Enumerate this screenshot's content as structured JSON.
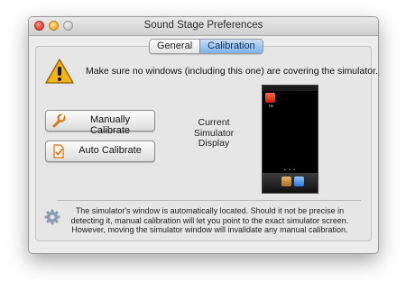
{
  "window": {
    "title": "Sound Stage Preferences",
    "controls": [
      "close-icon",
      "minimize-icon",
      "zoom-icon"
    ]
  },
  "tabs": [
    {
      "label": "General",
      "selected": false
    },
    {
      "label": "Calibration",
      "selected": true
    }
  ],
  "warning": {
    "icon": "warning-icon",
    "text": "Make sure no windows (including this one) are covering the simulator."
  },
  "buttons": {
    "manual": {
      "label": "Manually Calibrate",
      "icon": "wrench-icon"
    },
    "auto": {
      "label": "Auto Calibrate",
      "icon": "document-check-icon"
    }
  },
  "display": {
    "label": "Current Simulator Display",
    "preview": {
      "app_label": "Tiff",
      "page_dots": "• • •"
    }
  },
  "info": {
    "icon": "gear-icon",
    "text": "The simulator's window is automatically located. Should it not be precise in detecting it, manual calibration will let you point to the exact simulator screen. However, moving the simulator window will invalidate any manual calibration."
  },
  "colors": {
    "accent": "#7fb0e6",
    "window_bg": "#ececec",
    "warning": "#f2b21a"
  }
}
